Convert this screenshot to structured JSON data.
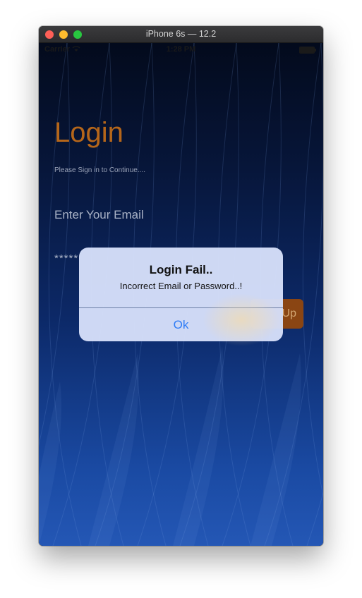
{
  "window": {
    "title": "iPhone 6s — 12.2"
  },
  "statusbar": {
    "carrier": "Carrier",
    "time": "1:28 PM"
  },
  "login": {
    "title": "Login",
    "subtitle": "Please Sign in to Continue....",
    "email_placeholder": "Enter Your Email",
    "password_value": "*****",
    "signup_label": "Up"
  },
  "alert": {
    "title": "Login Fail..",
    "message": "Incorrect Email or Password..!",
    "ok_label": "Ok"
  },
  "colors": {
    "accent_orange": "#b5661a",
    "alert_button_blue": "#2f7cf6"
  }
}
